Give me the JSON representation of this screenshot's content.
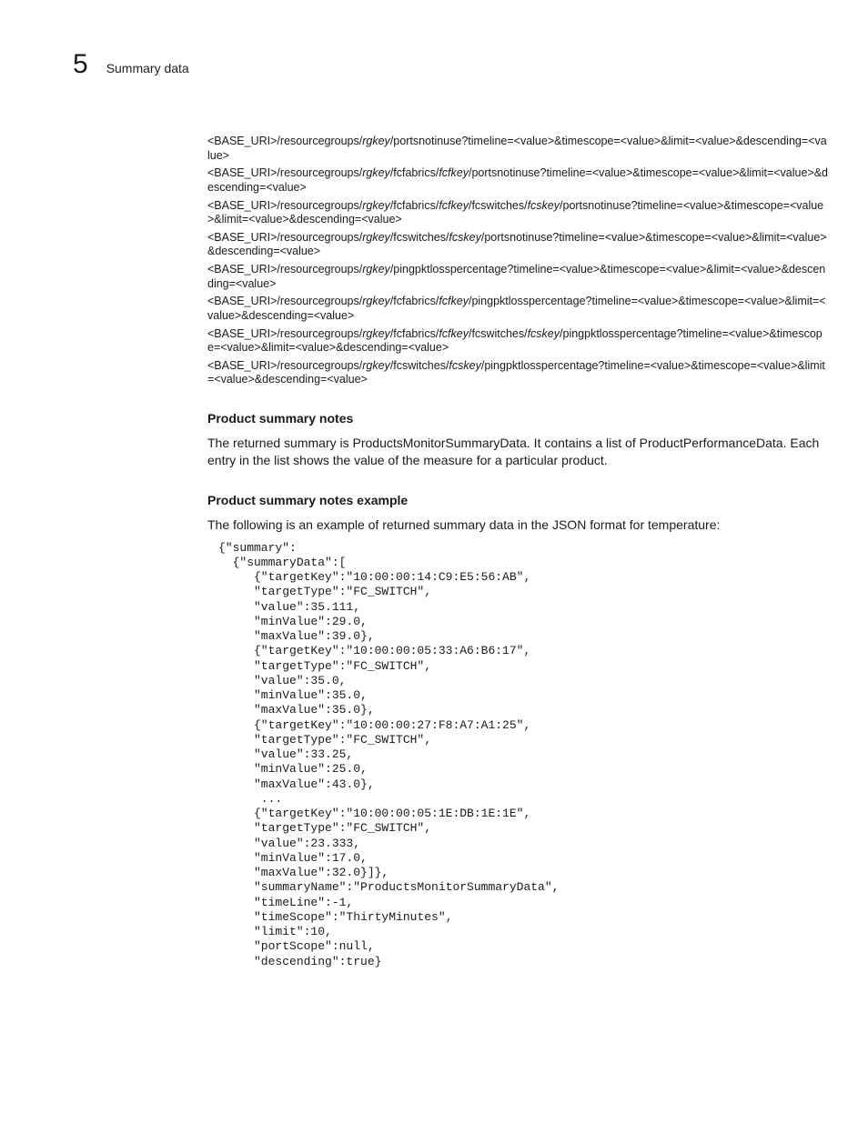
{
  "header": {
    "chapter_number": "5",
    "title": "Summary data"
  },
  "uri_lines": [
    {
      "segments": [
        {
          "t": "<BASE_URI>/resourcegroups/"
        },
        {
          "t": "rgkey",
          "i": true
        },
        {
          "t": "/portsnotinuse?timeline=<value>&timescope=<value>&limit=<value>&descending=<value>"
        }
      ]
    },
    {
      "segments": [
        {
          "t": "<BASE_URI>/resourcegroups/"
        },
        {
          "t": "rgkey",
          "i": true
        },
        {
          "t": "/fcfabrics/"
        },
        {
          "t": "fcfkey",
          "i": true
        },
        {
          "t": "/portsnotinuse?timeline=<value>&timescope=<value>&limit=<value>&descending=<value>"
        }
      ]
    },
    {
      "segments": [
        {
          "t": "<BASE_URI>/resourcegroups/"
        },
        {
          "t": "rgkey",
          "i": true
        },
        {
          "t": "/fcfabrics/"
        },
        {
          "t": "fcfkey",
          "i": true
        },
        {
          "t": "/fcswitches/"
        },
        {
          "t": "fcskey",
          "i": true
        },
        {
          "t": "/portsnotinuse?timeline=<value>&timescope=<value>&limit=<value>&descending=<value>"
        }
      ]
    },
    {
      "segments": [
        {
          "t": "<BASE_URI>/resourcegroups/"
        },
        {
          "t": "rgkey",
          "i": true
        },
        {
          "t": "/fcswitches/"
        },
        {
          "t": "fcskey",
          "i": true
        },
        {
          "t": "/portsnotinuse?timeline=<value>&timescope=<value>&limit=<value>&descending=<value>"
        }
      ]
    },
    {
      "segments": [
        {
          "t": "<BASE_URI>/resourcegroups/"
        },
        {
          "t": "rgkey",
          "i": true
        },
        {
          "t": "/pingpktlosspercentage?timeline=<value>&timescope=<value>&limit=<value>&descending=<value>"
        }
      ]
    },
    {
      "segments": [
        {
          "t": "<BASE_URI>/resourcegroups/"
        },
        {
          "t": "rgkey",
          "i": true
        },
        {
          "t": "/fcfabrics/"
        },
        {
          "t": "fcfkey",
          "i": true
        },
        {
          "t": "/pingpktlosspercentage?timeline=<value>&timescope=<value>&limit=<value>&descending=<value>"
        }
      ]
    },
    {
      "segments": [
        {
          "t": "<BASE_URI>/resourcegroups/"
        },
        {
          "t": "rgkey",
          "i": true
        },
        {
          "t": "/fcfabrics/"
        },
        {
          "t": "fcfkey",
          "i": true
        },
        {
          "t": "/fcswitches/"
        },
        {
          "t": "fcskey",
          "i": true
        },
        {
          "t": "/pingpktlosspercentage?timeline=<value>&timescope=<value>&limit=<value>&descending=<value>"
        }
      ]
    },
    {
      "segments": [
        {
          "t": "<BASE_URI>/resourcegroups/"
        },
        {
          "t": "rgkey",
          "i": true
        },
        {
          "t": "/fcswitches/"
        },
        {
          "t": "fcskey",
          "i": true
        },
        {
          "t": "/pingpktlosspercentage?timeline=<value>&timescope=<value>&limit=<value>&descending=<value>"
        }
      ]
    }
  ],
  "sections": {
    "notes_title": "Product summary notes",
    "notes_body": "The returned summary is ProductsMonitorSummaryData. It contains a list of ProductPerformanceData. Each entry in the list shows the value of the measure for a particular product.",
    "example_title": "Product summary notes example",
    "example_intro": "The following is an example of returned summary data in the JSON format for temperature:"
  },
  "code": "{\"summary\":\n  {\"summaryData\":[\n     {\"targetKey\":\"10:00:00:14:C9:E5:56:AB\",\n     \"targetType\":\"FC_SWITCH\",\n     \"value\":35.111,\n     \"minValue\":29.0,\n     \"maxValue\":39.0},\n     {\"targetKey\":\"10:00:00:05:33:A6:B6:17\",\n     \"targetType\":\"FC_SWITCH\",\n     \"value\":35.0,\n     \"minValue\":35.0,\n     \"maxValue\":35.0},\n     {\"targetKey\":\"10:00:00:27:F8:A7:A1:25\",\n     \"targetType\":\"FC_SWITCH\",\n     \"value\":33.25,\n     \"minValue\":25.0,\n     \"maxValue\":43.0},\n      ...\n     {\"targetKey\":\"10:00:00:05:1E:DB:1E:1E\",\n     \"targetType\":\"FC_SWITCH\",\n     \"value\":23.333,\n     \"minValue\":17.0,\n     \"maxValue\":32.0}]},\n     \"summaryName\":\"ProductsMonitorSummaryData\",\n     \"timeLine\":-1,\n     \"timeScope\":\"ThirtyMinutes\",\n     \"limit\":10,\n     \"portScope\":null,\n     \"descending\":true}"
}
